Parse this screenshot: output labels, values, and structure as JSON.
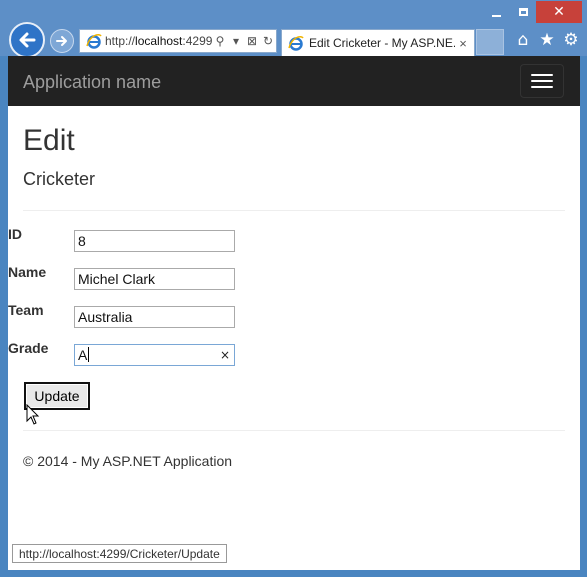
{
  "browser": {
    "address": {
      "host_prefix": "http://",
      "host": "localhost",
      "rest": ":4299"
    },
    "tab": {
      "title": "Edit Cricketer - My ASP.NE...",
      "close": "×"
    },
    "window": {
      "close": "✕"
    }
  },
  "navbar": {
    "brand": "Application name"
  },
  "page": {
    "title": "Edit",
    "subtitle": "Cricketer"
  },
  "form": {
    "fields": [
      {
        "label": "ID",
        "value": "8"
      },
      {
        "label": "Name",
        "value": "Michel Clark"
      },
      {
        "label": "Team",
        "value": "Australia"
      },
      {
        "label": "Grade",
        "value": "A"
      }
    ],
    "clear": "×",
    "submit_label": "Update"
  },
  "footer": {
    "text": "© 2014 - My ASP.NET Application"
  },
  "status_bar": {
    "url": "http://localhost:4299/Cricketer/Update"
  },
  "colors": {
    "navbar_bg": "#222222",
    "brand_text": "#9d9d9d",
    "chrome_bg": "#5d8fc7",
    "close_button": "#c7413a"
  }
}
